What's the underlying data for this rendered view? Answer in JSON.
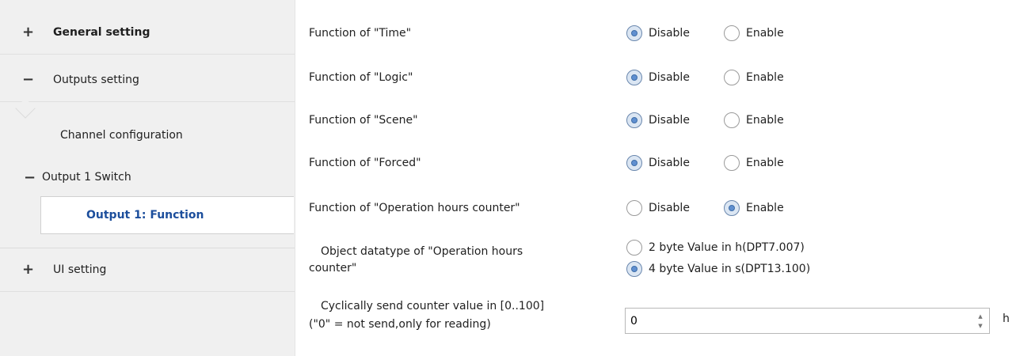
{
  "sidebar": {
    "general": {
      "sign": "+",
      "label": "General setting"
    },
    "outputs": {
      "sign": "−",
      "label": "Outputs setting"
    },
    "channel": {
      "label": "Channel configuration"
    },
    "output1": {
      "sign": "−",
      "label": "Output 1 Switch"
    },
    "function": {
      "label": "Output 1: Function"
    },
    "ui": {
      "sign": "+",
      "label": "UI setting"
    }
  },
  "params": [
    {
      "label": "Function of \"Time\"",
      "options": [
        "Disable",
        "Enable"
      ],
      "selected": "Disable"
    },
    {
      "label": "Function of \"Logic\"",
      "options": [
        "Disable",
        "Enable"
      ],
      "selected": "Disable"
    },
    {
      "label": "Function of \"Scene\"",
      "options": [
        "Disable",
        "Enable"
      ],
      "selected": "Disable"
    },
    {
      "label": "Function of \"Forced\"",
      "options": [
        "Disable",
        "Enable"
      ],
      "selected": "Disable"
    },
    {
      "label": "Function of \"Operation hours counter\"",
      "options": [
        "Disable",
        "Enable"
      ],
      "selected": "Enable"
    }
  ],
  "datatype": {
    "label_line1": "Object datatype of \"Operation hours",
    "label_line2": "counter\"",
    "options": [
      "2 byte Value in h(DPT7.007)",
      "4 byte Value in s(DPT13.100)"
    ],
    "selected": "4 byte Value in s(DPT13.100)"
  },
  "cyclic": {
    "label_line1": "Cyclically send counter value in [0..100]",
    "label_line2": "(\"0\" = not send,only for reading)",
    "value": "0",
    "unit": "h"
  },
  "colors": {
    "accent": "#1c4e9c",
    "radio_dot": "#5f8fd0",
    "sidebar_bg": "#f0f0f0"
  }
}
